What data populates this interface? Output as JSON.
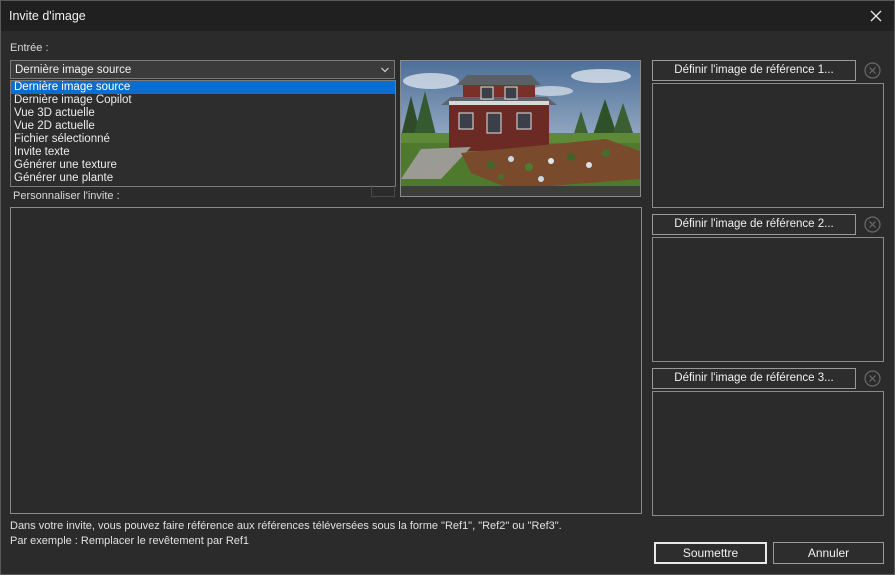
{
  "window": {
    "title": "Invite d'image"
  },
  "input": {
    "label": "Entrée :",
    "selected": "Dernière image source",
    "options": [
      "Dernière image source",
      "Dernière image Copilot",
      "Vue 3D actuelle",
      "Vue 2D actuelle",
      "Fichier sélectionné",
      "Invite texte",
      "Générer une texture",
      "Générer une plante"
    ]
  },
  "prompt": {
    "label": "Personnaliser l'invite :",
    "value": ""
  },
  "references": [
    {
      "button_label": "Définir l'image de référence 1..."
    },
    {
      "button_label": "Définir l'image de référence 2..."
    },
    {
      "button_label": "Définir l'image de référence 3..."
    }
  ],
  "hint": {
    "line1": "Dans votre invite, vous pouvez faire référence aux références téléversées sous la forme \"Ref1\", \"Ref2\" ou \"Ref3\".",
    "line2": "Par exemple : Remplacer le revêtement par Ref1"
  },
  "actions": {
    "submit": "Soumettre",
    "cancel": "Annuler"
  },
  "icons": {
    "close": "close-icon",
    "clear": "clear-circle-icon",
    "dropdown": "chevron-down-icon"
  }
}
